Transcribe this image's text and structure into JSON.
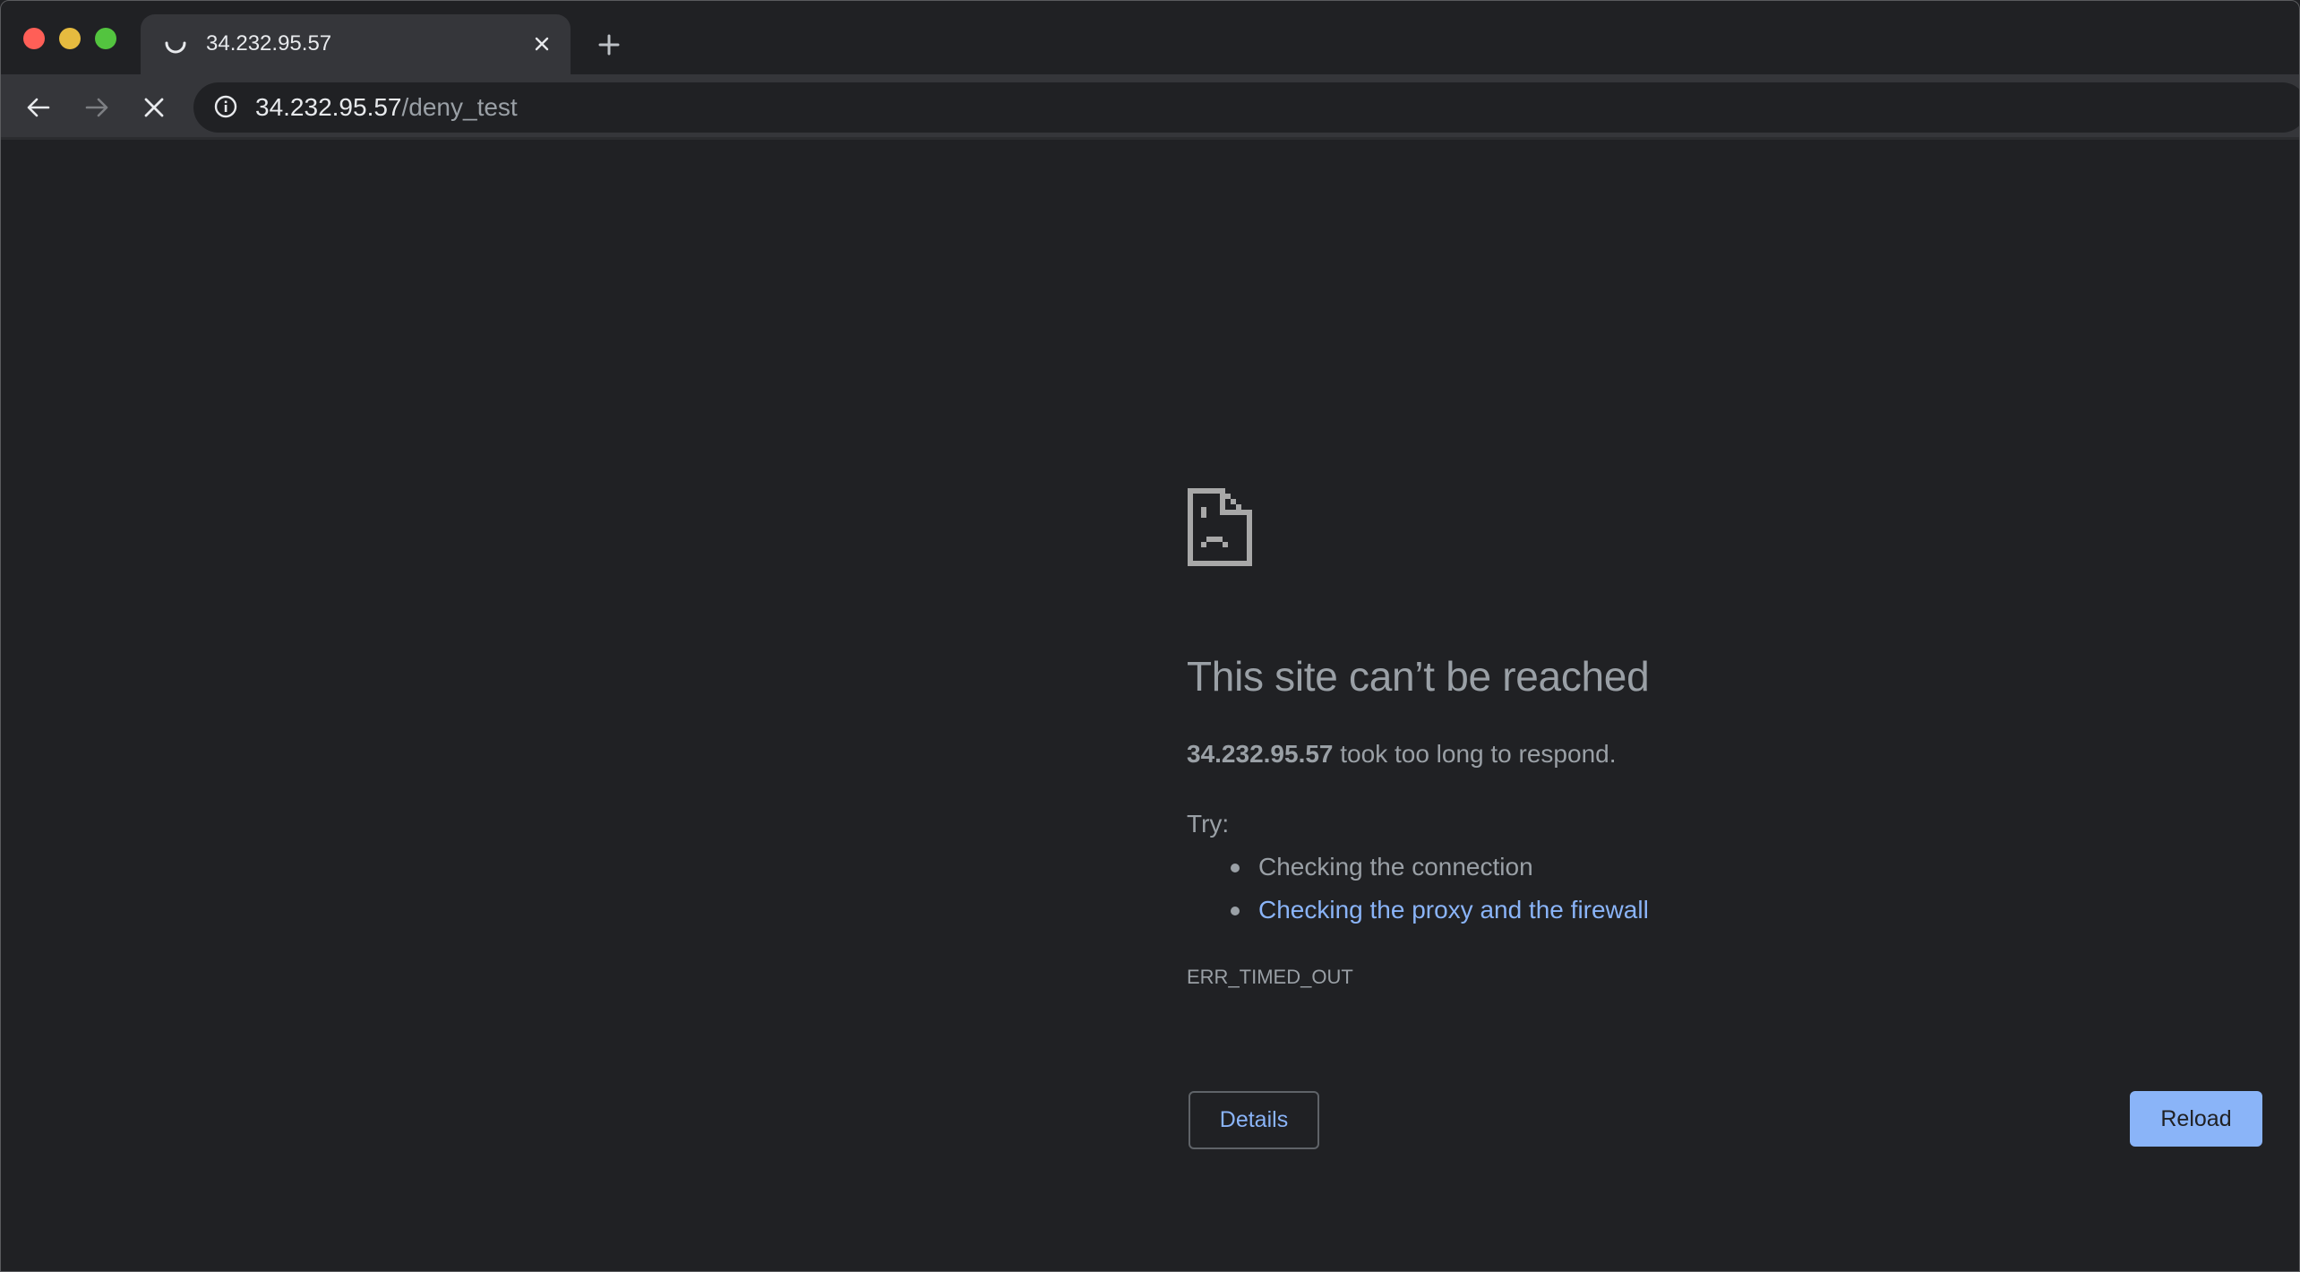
{
  "window": {
    "traffic_lights": [
      "close",
      "minimize",
      "maximize"
    ]
  },
  "tab": {
    "title": "34.232.95.57",
    "icon": "loading-spinner-icon",
    "close_icon": "close-icon"
  },
  "new_tab_icon": "plus-icon",
  "toolbar": {
    "back_icon": "arrow-left-icon",
    "forward_icon": "arrow-right-icon",
    "stop_icon": "stop-icon"
  },
  "omnibox": {
    "security_icon": "info-icon",
    "url_host": "34.232.95.57",
    "url_path": "/deny_test"
  },
  "error_page": {
    "icon": "sad-page-icon",
    "title": "This site can’t be reached",
    "host": "34.232.95.57",
    "message": " took too long to respond.",
    "try_label": "Try:",
    "suggestions": [
      {
        "text": "Checking the connection",
        "is_link": false
      },
      {
        "text": "Checking the proxy and the firewall",
        "is_link": true
      }
    ],
    "error_code": "ERR_TIMED_OUT",
    "details_button": "Details",
    "reload_button": "Reload"
  },
  "colors": {
    "page_bg": "#202124",
    "toolbar_bg": "#35363a",
    "text_secondary": "#9aa0a6",
    "link": "#8ab4f8",
    "primary_button": "#8ab4f8"
  }
}
